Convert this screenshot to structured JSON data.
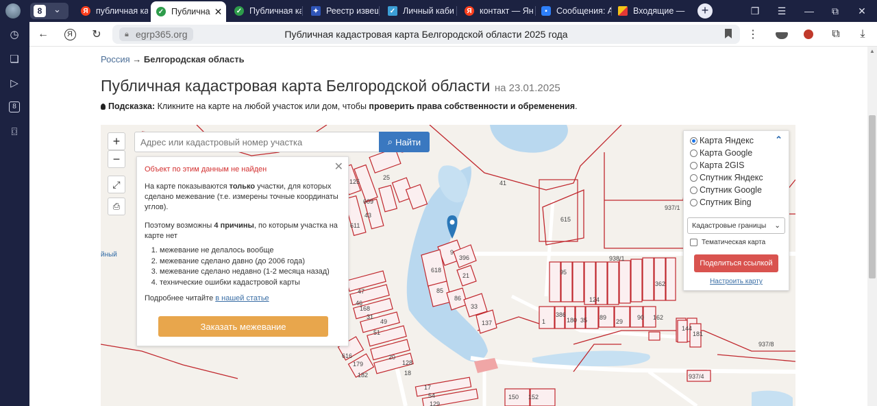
{
  "browser": {
    "tab_count_badge": "8",
    "tabs": [
      {
        "label": "публичная ка",
        "icon": "yandex-icon",
        "active": false
      },
      {
        "label": "Публична",
        "icon": "check-shield-icon",
        "active": true
      },
      {
        "label": "Публичная ка",
        "icon": "check-shield-icon",
        "active": false
      },
      {
        "label": "Реестр извещ",
        "icon": "emblem-icon",
        "active": false
      },
      {
        "label": "Личный каби",
        "icon": "rosreestr-icon",
        "active": false
      },
      {
        "label": "контакт — Ян",
        "icon": "yandex-icon",
        "active": false
      },
      {
        "label": "Сообщения: А",
        "icon": "messenger-icon",
        "active": false
      },
      {
        "label": "Входящие — ",
        "icon": "mail-icon",
        "active": false
      }
    ],
    "sidebar_badge": "8",
    "domain": "egrp365.org",
    "page_title": "Публичная кадастровая карта Белгородской области 2025 года"
  },
  "page": {
    "breadcrumb_root": "Россия",
    "breadcrumb_arrow": "→",
    "breadcrumb_current": "Белгородская область",
    "title": "Публичная кадастровая карта Белгородской области",
    "title_date": "на 23.01.2025",
    "hint_label": "Подсказка:",
    "hint_text": " Кликните на карте на любой участок или дом, чтобы ",
    "hint_bold": "проверить права собственности и обременения",
    "hint_end": "."
  },
  "map": {
    "search_placeholder": "Адрес или кадастровый номер участка",
    "search_button": "Найти",
    "zoom_in": "+",
    "zoom_out": "−",
    "edge_label": "йный",
    "popup": {
      "error": "Объект по этим данным не найден",
      "p1_a": "На карте показываются ",
      "p1_b": "только",
      "p1_c": " участки, для которых сделано межевание (т.е. измерены точные координаты углов).",
      "p2_a": "Поэтому возможны ",
      "p2_b": "4 причины",
      "p2_c": ", по которым участка на карте нет",
      "reasons": [
        "межевание не делалось вообще",
        "межевание сделано давно (до 2006 года)",
        "межевание сделано недавно (1-2 месяца назад)",
        "технические ошибки кадастровой карты"
      ],
      "more_text": "Подробнее читайте ",
      "more_link": "в нашей статье",
      "order_button": "Заказать межевание"
    },
    "layers": {
      "options": [
        "Карта Яндекс",
        "Карта Google",
        "Карта 2GIS",
        "Спутник Яндекс",
        "Спутник Google",
        "Спутник Bing"
      ],
      "selected": "Карта Яндекс",
      "boundaries_select": "Кадастровые границы",
      "thematic_label": "Тематическая карта",
      "share_button": "Поделиться ссылкой",
      "configure_link": "Настроить карту"
    },
    "parcel_labels": [
      "41",
      "615",
      "937/1",
      "938/1",
      "9",
      "396",
      "618",
      "21",
      "85",
      "86",
      "33",
      "137",
      "95",
      "124",
      "362",
      "386",
      "180",
      "35",
      "89",
      "29",
      "90",
      "162",
      "1",
      "144",
      "181",
      "937/8",
      "937/4",
      "150",
      "152",
      "125",
      "25",
      "609",
      "611",
      "43",
      "47",
      "46",
      "168",
      "31",
      "49",
      "51",
      "616",
      "179",
      "20",
      "128",
      "18",
      "182",
      "17",
      "54",
      "129"
    ],
    "colors": {
      "parcel": "#c0272d",
      "water": "#b9d8ef",
      "road": "#ffffff",
      "accent": "#3a78c0"
    }
  }
}
